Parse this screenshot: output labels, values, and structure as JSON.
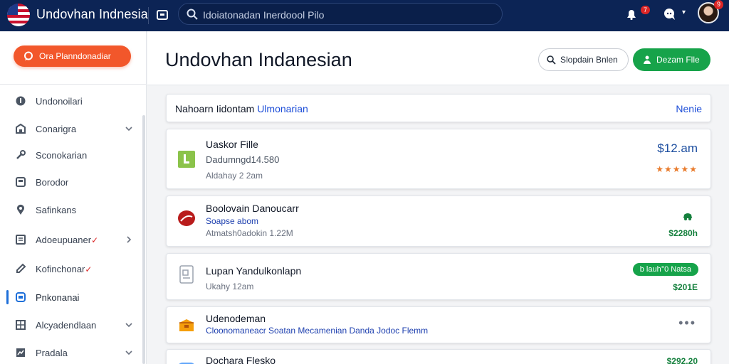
{
  "app": {
    "title": "Undovhan Indnesia"
  },
  "topbar": {
    "search_text": "Idoiatonadan Inerdoool Pilo",
    "notif_count": "7",
    "avatar_count": "9"
  },
  "sidebar": {
    "compose_label": "Ora Planndonadiar",
    "items": [
      {
        "label": "Undonoilari",
        "icon": "info-icon",
        "chevron": false,
        "check": false
      },
      {
        "label": "Conarigra",
        "icon": "building-icon",
        "chevron": true,
        "check": false
      },
      {
        "label": "Sconokarian",
        "icon": "tools-icon",
        "chevron": false,
        "check": false
      },
      {
        "label": "Borodor",
        "icon": "box-icon",
        "chevron": false,
        "check": false
      },
      {
        "label": "Safinkans",
        "icon": "pin-icon",
        "chevron": false,
        "check": false
      },
      {
        "label": "Adoeupuaner",
        "icon": "list-icon",
        "chevron": true,
        "check": true
      },
      {
        "label": "Kofinchonar",
        "icon": "edit-icon",
        "chevron": false,
        "check": true
      },
      {
        "label": "Pnkonanai",
        "icon": "window-icon",
        "chevron": false,
        "check": false
      },
      {
        "label": "Alcyadendlaan",
        "icon": "grid-icon",
        "chevron": true,
        "check": false
      },
      {
        "label": "Pradala",
        "icon": "chart-icon",
        "chevron": true,
        "check": false
      }
    ]
  },
  "main": {
    "title": "Undovhan Indanesian",
    "btn_secondary": "Slopdain Bnlen",
    "btn_primary": "Dezam Flle",
    "filter": {
      "text": "Nahoarn Iidontam",
      "accent": "Ulmonarian",
      "right": "Nenie"
    },
    "items": [
      {
        "title": "Uaskor Fille",
        "sub": "Dadumngd14.580",
        "meta": "Aldahay 2 2am",
        "price": "$12.am",
        "stars": "★★★★★"
      },
      {
        "title": "Boolovain Danoucarr",
        "sub": "Soapse abom",
        "meta": "Atmatsh0adokin 1.22M",
        "price": "$2280h"
      },
      {
        "title": "Lupan Yandulkonlapn",
        "meta": "Ukahy 12am",
        "pill": "b lauh°0 Natsa",
        "price": "$201E"
      },
      {
        "title": "Udenodeman",
        "sub": "Cloonomaneacr Soatan Mecamenian Danda Jodoc Flemm"
      },
      {
        "title": "Dochara Flesko",
        "price": "$292.20"
      }
    ]
  },
  "colors": {
    "topbar": "#0c2455",
    "accent_orange": "#f2572b",
    "accent_green": "#17a34a",
    "link_blue": "#1d4ed8"
  }
}
